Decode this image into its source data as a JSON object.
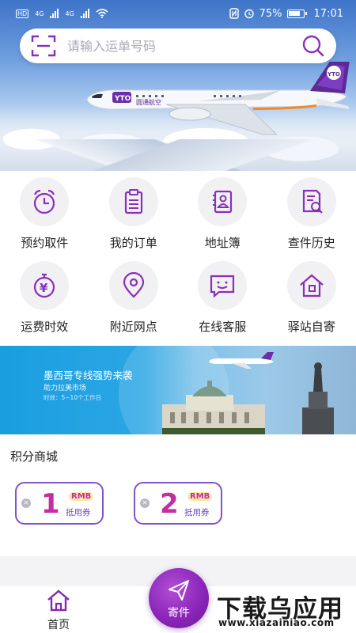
{
  "status_bar": {
    "hd1": "HD",
    "hd2": "HD",
    "net1": "4G",
    "net2": "4G",
    "battery": "75%",
    "time": "17:01"
  },
  "search": {
    "placeholder": "请输入运单号码"
  },
  "hero": {
    "brand_text": "圆通航空",
    "plane_logo": "YTO"
  },
  "grid": {
    "items": [
      {
        "label": "预约取件",
        "icon": "alarm-clock-icon"
      },
      {
        "label": "我的订单",
        "icon": "clipboard-list-icon"
      },
      {
        "label": "地址簿",
        "icon": "contact-book-icon"
      },
      {
        "label": "查件历史",
        "icon": "document-search-icon"
      },
      {
        "label": "运费时效",
        "icon": "yuan-stopwatch-icon"
      },
      {
        "label": "附近网点",
        "icon": "location-pin-icon"
      },
      {
        "label": "在线客服",
        "icon": "chat-smile-icon"
      },
      {
        "label": "驿站自寄",
        "icon": "house-icon"
      }
    ]
  },
  "banner": {
    "title": "墨西哥专线强势来袭",
    "subtitle": "助力拉美市场",
    "note": "时效：5~10个工作日"
  },
  "points_mall": {
    "title": "积分商城",
    "coupons": [
      {
        "amount": "1",
        "currency": "RMB",
        "desc": "抵用券"
      },
      {
        "amount": "2",
        "currency": "RMB",
        "desc": "抵用券"
      }
    ]
  },
  "bottom_nav": {
    "home_label": "首页",
    "send_label": "寄件"
  },
  "watermark": {
    "title": "下载乌应用",
    "url": "www.xiazainiao.com"
  },
  "colors": {
    "accent": "#7f2bb3",
    "coupon_number": "#c42ea0",
    "coupon_border": "#7f54c8"
  }
}
